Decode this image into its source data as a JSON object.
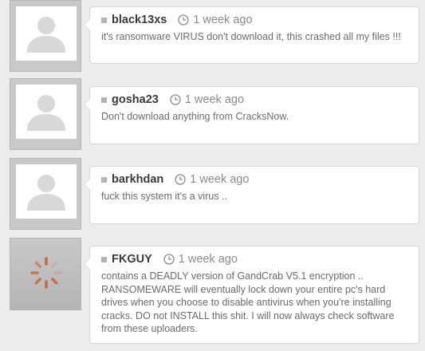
{
  "comments": [
    {
      "author": "black13xs",
      "time": "1 week ago",
      "text": "it's ransomware VIRUS don't download it, this crashed all my files !!!"
    },
    {
      "author": "gosha23",
      "time": "1 week ago",
      "text": "Don't download anything from CracksNow."
    },
    {
      "author": "barkhdan",
      "time": "1 week ago",
      "text": "fuck this system it's a virus .."
    },
    {
      "author": "FKGUY",
      "time": "1 week ago",
      "text": "contains a DEADLY version of GandCrab V5.1 encryption .. RANSOMEWARE will eventually lock down your entire pc's hard drives when you choose to disable antivirus when you're installing cracks. DO not INSTALL this shit. I will now always check software from these uploaders."
    }
  ],
  "icons": {
    "avatar": "default-user-avatar-icon",
    "clock": "clock-icon",
    "loading": "loading-spinner-icon"
  },
  "colors": {
    "background": "#ececec",
    "author": "#3a3a3a",
    "text": "#6b6b6b",
    "spinner": "#c7622a"
  }
}
